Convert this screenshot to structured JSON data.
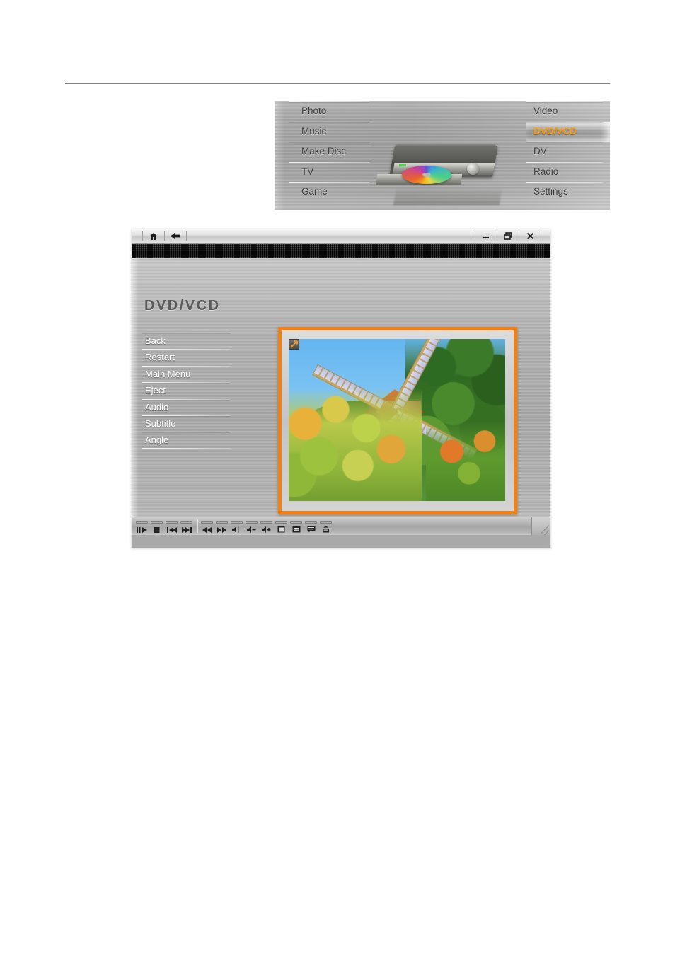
{
  "top_menu": {
    "left_column": [
      {
        "label": "Photo",
        "selected": false
      },
      {
        "label": "Music",
        "selected": false
      },
      {
        "label": "Make Disc",
        "selected": false
      },
      {
        "label": "TV",
        "selected": false
      },
      {
        "label": "Game",
        "selected": false
      }
    ],
    "right_column": [
      {
        "label": "Video",
        "selected": false
      },
      {
        "label": "DVD/VCD",
        "selected": true
      },
      {
        "label": "DV",
        "selected": false
      },
      {
        "label": "Radio",
        "selected": false
      },
      {
        "label": "Settings",
        "selected": false
      }
    ],
    "selected_label": "DVD/VCD",
    "highlight_color": "#ff9b00",
    "illustration": "dvd-player-with-open-tray-and-disc"
  },
  "window": {
    "titlebar": {
      "nav": [
        {
          "name": "home-icon",
          "title": "Home"
        },
        {
          "name": "back-arrow-icon",
          "title": "Back"
        }
      ],
      "controls": [
        {
          "name": "minimize-button",
          "title": "Minimize"
        },
        {
          "name": "restore-button",
          "title": "Restore"
        },
        {
          "name": "close-button",
          "title": "Close"
        }
      ]
    },
    "title": "DVD/VCD",
    "sidebar": [
      {
        "label": "Back"
      },
      {
        "label": "Restart"
      },
      {
        "label": "Main Menu"
      },
      {
        "label": "Eject"
      },
      {
        "label": "Audio"
      },
      {
        "label": "Subtitle"
      },
      {
        "label": "Angle"
      }
    ],
    "video": {
      "frame_color": "#f08018",
      "expand_badge": "expand-arrow-icon",
      "content": "windmill-in-autumn-garden-under-blue-sky"
    },
    "controls": {
      "group_transport": [
        {
          "name": "play-pause-button",
          "title": "Play / Pause"
        },
        {
          "name": "stop-button",
          "title": "Stop"
        },
        {
          "name": "previous-button",
          "title": "Previous"
        },
        {
          "name": "next-button",
          "title": "Next"
        }
      ],
      "group_playback": [
        {
          "name": "rewind-button",
          "title": "Rewind"
        },
        {
          "name": "fast-forward-button",
          "title": "Fast Forward"
        },
        {
          "name": "mute-button",
          "title": "Mute"
        },
        {
          "name": "volume-down-button",
          "title": "Volume Down"
        },
        {
          "name": "volume-up-button",
          "title": "Volume Up"
        },
        {
          "name": "fullscreen-button",
          "title": "Full Screen"
        },
        {
          "name": "subtitle-button",
          "title": "Subtitle"
        },
        {
          "name": "menu-button",
          "title": "Menu"
        },
        {
          "name": "eject-button",
          "title": "Eject"
        }
      ]
    },
    "resize_grip": "resize-grip-icon"
  }
}
